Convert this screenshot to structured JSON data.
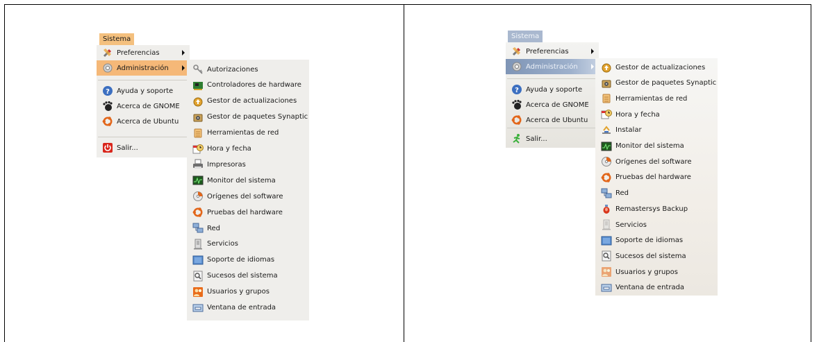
{
  "left": {
    "menu_bar_label": "Sistema",
    "main_menu": [
      {
        "label": "Preferencias",
        "icon": "preferences-icon",
        "submenu": true
      },
      {
        "label": "Administración",
        "icon": "administration-icon",
        "submenu": true,
        "selected": true
      },
      {
        "label": "Ayuda y soporte",
        "icon": "help-icon"
      },
      {
        "label": "Acerca de GNOME",
        "icon": "gnome-foot-icon"
      },
      {
        "label": "Acerca de Ubuntu",
        "icon": "ubuntu-icon"
      },
      {
        "label": "Salir...",
        "icon": "power-icon"
      }
    ],
    "submenu": [
      {
        "label": "Autorizaciones",
        "icon": "keys-icon"
      },
      {
        "label": "Controladores de hardware",
        "icon": "hardware-drivers-icon"
      },
      {
        "label": "Gestor de actualizaciones",
        "icon": "update-manager-icon"
      },
      {
        "label": "Gestor de paquetes Synaptic",
        "icon": "synaptic-icon"
      },
      {
        "label": "Herramientas de red",
        "icon": "network-tools-icon"
      },
      {
        "label": "Hora y fecha",
        "icon": "clock-icon"
      },
      {
        "label": "Impresoras",
        "icon": "printer-icon"
      },
      {
        "label": "Monitor del sistema",
        "icon": "system-monitor-icon"
      },
      {
        "label": "Orígenes del software",
        "icon": "software-sources-icon"
      },
      {
        "label": "Pruebas del hardware",
        "icon": "hardware-test-icon"
      },
      {
        "label": "Red",
        "icon": "network-icon"
      },
      {
        "label": "Servicios",
        "icon": "services-icon"
      },
      {
        "label": "Soporte de idiomas",
        "icon": "language-support-icon"
      },
      {
        "label": "Sucesos del sistema",
        "icon": "system-log-icon"
      },
      {
        "label": "Usuarios y grupos",
        "icon": "users-groups-icon"
      },
      {
        "label": "Ventana de entrada",
        "icon": "login-window-icon"
      }
    ]
  },
  "right": {
    "menu_bar_label": "Sistema",
    "main_menu": [
      {
        "label": "Preferencias",
        "icon": "preferences-icon",
        "submenu": true
      },
      {
        "label": "Administración",
        "icon": "administration-icon",
        "submenu": true,
        "selected": true
      },
      {
        "label": "Ayuda y soporte",
        "icon": "help-icon"
      },
      {
        "label": "Acerca de GNOME",
        "icon": "gnome-foot-icon"
      },
      {
        "label": "Acerca de Ubuntu",
        "icon": "ubuntu-icon"
      },
      {
        "label": "Salir...",
        "icon": "exit-runner-icon"
      }
    ],
    "submenu": [
      {
        "label": "Gestor de actualizaciones",
        "icon": "update-manager-icon"
      },
      {
        "label": "Gestor de paquetes Synaptic",
        "icon": "synaptic-icon"
      },
      {
        "label": "Herramientas de red",
        "icon": "network-tools-icon"
      },
      {
        "label": "Hora y fecha",
        "icon": "clock-icon"
      },
      {
        "label": "Instalar",
        "icon": "install-icon"
      },
      {
        "label": "Monitor del sistema",
        "icon": "system-monitor-icon"
      },
      {
        "label": "Orígenes del software",
        "icon": "software-sources-icon"
      },
      {
        "label": "Pruebas del hardware",
        "icon": "hardware-test-icon"
      },
      {
        "label": "Red",
        "icon": "network-icon"
      },
      {
        "label": "Remastersys Backup",
        "icon": "remastersys-icon"
      },
      {
        "label": "Servicios",
        "icon": "services-icon"
      },
      {
        "label": "Soporte de idiomas",
        "icon": "language-support-icon"
      },
      {
        "label": "Sucesos del sistema",
        "icon": "system-log-icon"
      },
      {
        "label": "Usuarios y grupos",
        "icon": "users-groups-icon"
      },
      {
        "label": "Ventana de entrada",
        "icon": "login-window-icon"
      }
    ]
  },
  "colors": {
    "left_highlight": "#f5b878",
    "right_highlight": "#8ea2c1",
    "menu_background": "#efeeeb"
  }
}
